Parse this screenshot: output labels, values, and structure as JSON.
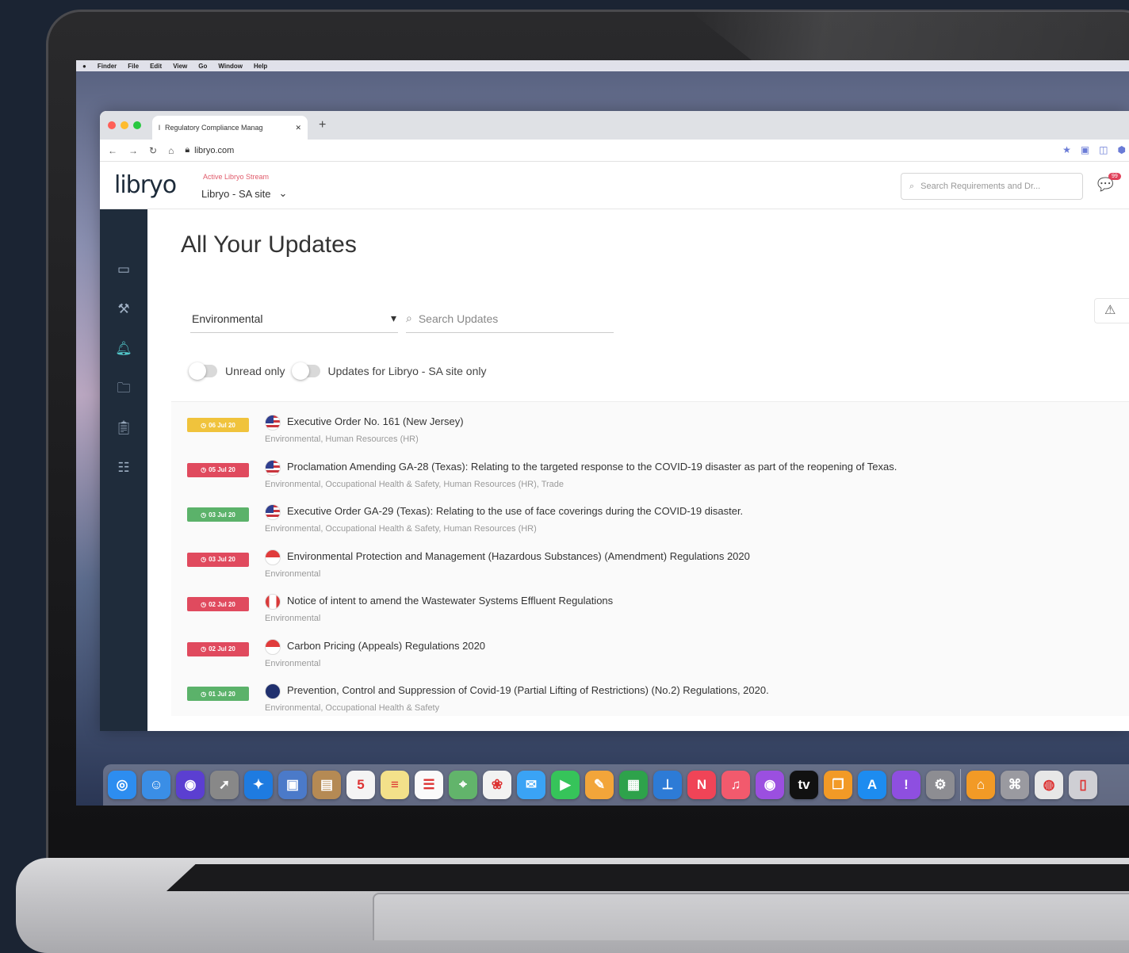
{
  "menubar": {
    "items": [
      "Finder",
      "File",
      "Edit",
      "View",
      "Go",
      "Window",
      "Help"
    ]
  },
  "browser": {
    "tab_title": "Regulatory Compliance Manag",
    "url": "libryo.com"
  },
  "header": {
    "logo": "libryo",
    "stream_label": "Active Libryo Stream",
    "stream_value": "Libryo - SA site",
    "search_placeholder": "Search Requirements and Dr...",
    "chat_badge": "99"
  },
  "main": {
    "title": "All Your Updates",
    "filter_value": "Environmental",
    "search_placeholder": "Search Updates",
    "toggle_unread": "Unread only",
    "toggle_site": "Updates for Libryo - SA site only"
  },
  "updates": [
    {
      "date": "06 Jul 20",
      "color": "#f0c33c",
      "flag": "us",
      "title": "Executive Order No. 161 (New Jersey)",
      "tags": "Environmental, Human Resources (HR)"
    },
    {
      "date": "05 Jul 20",
      "color": "#e04a5e",
      "flag": "us",
      "title": "Proclamation Amending GA-28 (Texas): Relating to the targeted response to the COVID-19 disaster as part of the reopening of Texas.",
      "tags": "Environmental, Occupational Health & Safety, Human Resources (HR), Trade"
    },
    {
      "date": "03 Jul 20",
      "color": "#5bb26a",
      "flag": "us",
      "title": "Executive Order GA-29 (Texas): Relating to the use of face coverings during the COVID-19 disaster.",
      "tags": "Environmental, Occupational Health & Safety, Human Resources (HR)"
    },
    {
      "date": "03 Jul 20",
      "color": "#e04a5e",
      "flag": "sg",
      "title": "Environmental Protection and Management (Hazardous Substances) (Amendment) Regulations 2020",
      "tags": "Environmental"
    },
    {
      "date": "02 Jul 20",
      "color": "#e04a5e",
      "flag": "ca",
      "title": "Notice of intent to amend the Wastewater Systems Effluent Regulations",
      "tags": "Environmental"
    },
    {
      "date": "02 Jul 20",
      "color": "#e04a5e",
      "flag": "sg",
      "title": "Carbon Pricing (Appeals) Regulations 2020",
      "tags": "Environmental"
    },
    {
      "date": "01 Jul 20",
      "color": "#5bb26a",
      "flag": "au",
      "title": "Prevention, Control and Suppression of Covid-19 (Partial Lifting of Restrictions) (No.2) Regulations, 2020.",
      "tags": "Environmental, Occupational Health & Safety"
    }
  ],
  "dock": [
    {
      "name": "safari-icon",
      "color": "#2d8df0",
      "glyph": "◎"
    },
    {
      "name": "finder-icon",
      "color": "#3a8ee6",
      "glyph": "☺"
    },
    {
      "name": "siri-icon",
      "color": "#5b3fd1",
      "glyph": "◉"
    },
    {
      "name": "launchpad-icon",
      "color": "#888",
      "glyph": "➚"
    },
    {
      "name": "safari-alt-icon",
      "color": "#1e7be0",
      "glyph": "✦"
    },
    {
      "name": "preview-icon",
      "color": "#4b7ac9",
      "glyph": "▣"
    },
    {
      "name": "contacts-icon",
      "color": "#b58a54",
      "glyph": "▤"
    },
    {
      "name": "calendar-icon",
      "color": "#f4f4f4",
      "glyph": "5"
    },
    {
      "name": "notes-icon",
      "color": "#f3e18a",
      "glyph": "≡"
    },
    {
      "name": "reminders-icon",
      "color": "#fafafa",
      "glyph": "☰"
    },
    {
      "name": "maps-icon",
      "color": "#62b46b",
      "glyph": "⌖"
    },
    {
      "name": "photos-icon",
      "color": "#f2f2f2",
      "glyph": "❀"
    },
    {
      "name": "messages-icon",
      "color": "#3aa3f5",
      "glyph": "✉"
    },
    {
      "name": "facetime-icon",
      "color": "#36c45a",
      "glyph": "▶"
    },
    {
      "name": "pages-icon",
      "color": "#f2a53a",
      "glyph": "✎"
    },
    {
      "name": "numbers-icon",
      "color": "#2ea24b",
      "glyph": "▦"
    },
    {
      "name": "keynote-icon",
      "color": "#2d7bd6",
      "glyph": "⊥"
    },
    {
      "name": "news-icon",
      "color": "#f04457",
      "glyph": "N"
    },
    {
      "name": "music-icon",
      "color": "#f25a6d",
      "glyph": "♫"
    },
    {
      "name": "podcasts-icon",
      "color": "#9b4fe0",
      "glyph": "◉"
    },
    {
      "name": "tv-icon",
      "color": "#111",
      "glyph": "tv"
    },
    {
      "name": "books-icon",
      "color": "#f29a26",
      "glyph": "❐"
    },
    {
      "name": "appstore-icon",
      "color": "#1d8cf0",
      "glyph": "A"
    },
    {
      "name": "feedback-icon",
      "color": "#8e4fe0",
      "glyph": "!"
    },
    {
      "name": "settings-icon",
      "color": "#8d8d92",
      "glyph": "⚙"
    },
    {
      "name": "home-icon",
      "color": "#f29a26",
      "glyph": "⌂"
    },
    {
      "name": "utility-icon",
      "color": "#9a9aa0",
      "glyph": "⌘"
    },
    {
      "name": "chrome-icon",
      "color": "#e7e7e7",
      "glyph": "◍"
    },
    {
      "name": "trash-icon",
      "color": "#cfcfd4",
      "glyph": "▯"
    }
  ]
}
